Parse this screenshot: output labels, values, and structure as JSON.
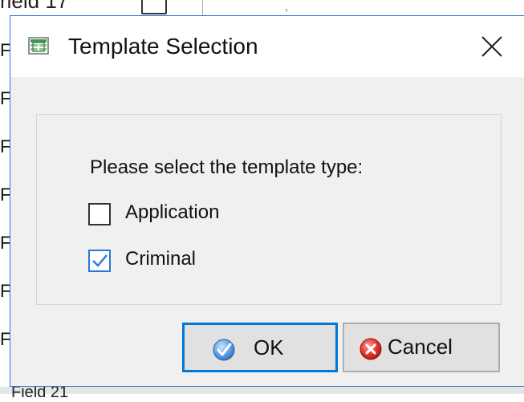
{
  "background": {
    "top_text": "rield 17",
    "bottom_text": "Field 21"
  },
  "dialog": {
    "title": "Template Selection",
    "title_icon": "template-spreadsheet-icon",
    "close_icon": "close-icon",
    "prompt": "Please select the template type:",
    "options": [
      {
        "label": "Application",
        "checked": false
      },
      {
        "label": "Criminal",
        "checked": true
      }
    ],
    "buttons": {
      "ok": {
        "label": "OK",
        "icon": "check-shield-icon"
      },
      "cancel": {
        "label": "Cancel",
        "icon": "red-x-icon"
      }
    }
  },
  "colors": {
    "accent": "#0078d7",
    "dialog_bg": "#f0f0f0",
    "button_bg": "#e1e1e1"
  }
}
